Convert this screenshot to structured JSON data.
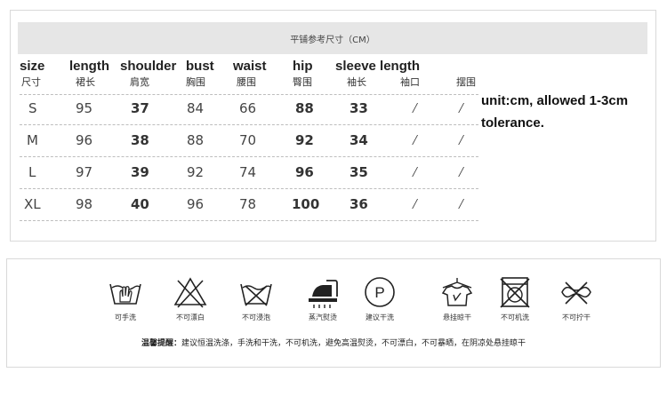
{
  "banner": {
    "title": "平铺参考尺寸（CM）"
  },
  "headers": [
    {
      "en": "size",
      "cn": "尺寸"
    },
    {
      "en": "length",
      "cn": "裙长"
    },
    {
      "en": "shoulder",
      "cn": "肩宽"
    },
    {
      "en": "bust",
      "cn": "胸围"
    },
    {
      "en": "waist",
      "cn": "腰围"
    },
    {
      "en": "hip",
      "cn": "臀围"
    },
    {
      "en": "sleeve length",
      "cn": "袖长"
    },
    {
      "en": "",
      "cn": "袖口"
    },
    {
      "en": "",
      "cn": "摆围"
    }
  ],
  "rows": [
    {
      "size": "S",
      "length": "95",
      "shoulder": "37",
      "bust": "84",
      "waist": "66",
      "hip": "88",
      "sleeve": "33",
      "cuff": "/",
      "hem": "/"
    },
    {
      "size": "M",
      "length": "96",
      "shoulder": "38",
      "bust": "88",
      "waist": "70",
      "hip": "92",
      "sleeve": "34",
      "cuff": "/",
      "hem": "/"
    },
    {
      "size": "L",
      "length": "97",
      "shoulder": "39",
      "bust": "92",
      "waist": "74",
      "hip": "96",
      "sleeve": "35",
      "cuff": "/",
      "hem": "/"
    },
    {
      "size": "XL",
      "length": "98",
      "shoulder": "40",
      "bust": "96",
      "waist": "78",
      "hip": "100",
      "sleeve": "36",
      "cuff": "/",
      "hem": "/"
    }
  ],
  "note": "unit:cm, allowed 1-3cm tolerance.",
  "care": [
    {
      "icon": "hand-wash-icon",
      "label": "可手洗"
    },
    {
      "icon": "no-bleach-icon",
      "label": "不可漂白"
    },
    {
      "icon": "no-soak-icon",
      "label": "不可浸泡"
    },
    {
      "icon": "steam-iron-icon",
      "label": "蒸汽熨烫"
    },
    {
      "icon": "dry-clean-icon",
      "label": "建议干洗"
    },
    {
      "icon": "hang-dry-icon",
      "label": "悬挂晾干"
    },
    {
      "icon": "no-machine-wash-icon",
      "label": "不可机洗"
    },
    {
      "icon": "no-wring-icon",
      "label": "不可拧干"
    }
  ],
  "dry_clean_letter": "P",
  "tip": {
    "label": "温馨提醒：",
    "text": "建议恒温洗涤，手洗和干洗，不可机洗，避免高温熨烫，不可漂白，不可暴晒，在阴凉处悬挂晾干"
  }
}
